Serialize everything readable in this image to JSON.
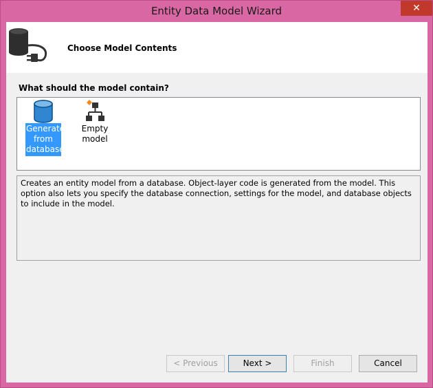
{
  "window": {
    "title": "Entity Data Model Wizard",
    "close_glyph": "✕"
  },
  "header": {
    "title": "Choose Model Contents",
    "icon": "database-plug-icon"
  },
  "question": "What should the model contain?",
  "options": [
    {
      "label": "Generate from database",
      "icon": "database-icon",
      "selected": true
    },
    {
      "label": "Empty model",
      "icon": "hierarchy-icon",
      "selected": false
    }
  ],
  "description": "Creates an entity model from a database. Object-layer code is generated from the model. This option also lets you specify the database connection, settings for the model, and database objects to include in the model.",
  "buttons": {
    "previous": "< Previous",
    "next": "Next >",
    "finish": "Finish",
    "cancel": "Cancel"
  },
  "colors": {
    "title_bar": "#d967a4",
    "selection": "#3399ff"
  }
}
